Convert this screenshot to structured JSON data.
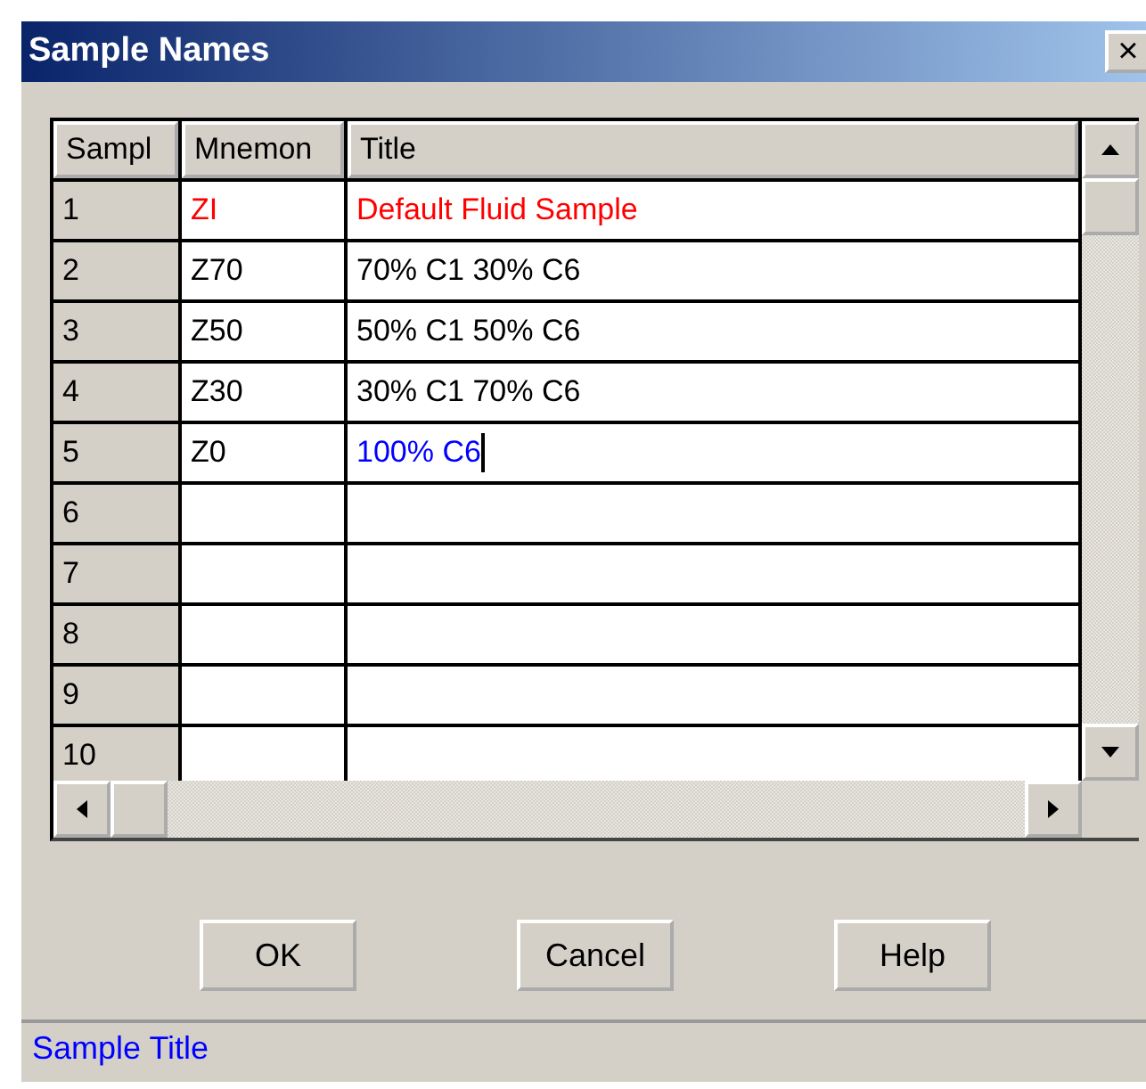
{
  "window": {
    "title": "Sample Names",
    "close": "×"
  },
  "table": {
    "columns": [
      "Sampl",
      "Mnemon",
      "Title"
    ],
    "rows": [
      {
        "number": "1",
        "mnemonic": {
          "text": "ZI",
          "color": "#ff0000"
        },
        "title": {
          "text": "Default Fluid Sample",
          "color": "#ff0000"
        },
        "editing": false
      },
      {
        "number": "2",
        "mnemonic": {
          "text": "Z70",
          "color": "#000000"
        },
        "title": {
          "text": "70% C1 30% C6",
          "color": "#000000"
        },
        "editing": false
      },
      {
        "number": "3",
        "mnemonic": {
          "text": "Z50",
          "color": "#000000"
        },
        "title": {
          "text": "50% C1 50% C6",
          "color": "#000000"
        },
        "editing": false
      },
      {
        "number": "4",
        "mnemonic": {
          "text": "Z30",
          "color": "#000000"
        },
        "title": {
          "text": "30% C1 70% C6",
          "color": "#000000"
        },
        "editing": false
      },
      {
        "number": "5",
        "mnemonic": {
          "text": "Z0",
          "color": "#000000"
        },
        "title": {
          "text": "100% C6",
          "color": "#0000ff"
        },
        "editing": true
      },
      {
        "number": "6",
        "editing": false
      },
      {
        "number": "7",
        "editing": false
      },
      {
        "number": "8",
        "editing": false
      },
      {
        "number": "9",
        "editing": false
      },
      {
        "number": "10",
        "editing": false
      }
    ]
  },
  "buttons": [
    "OK",
    "Cancel",
    "Help"
  ],
  "status_bar": "Sample Title"
}
